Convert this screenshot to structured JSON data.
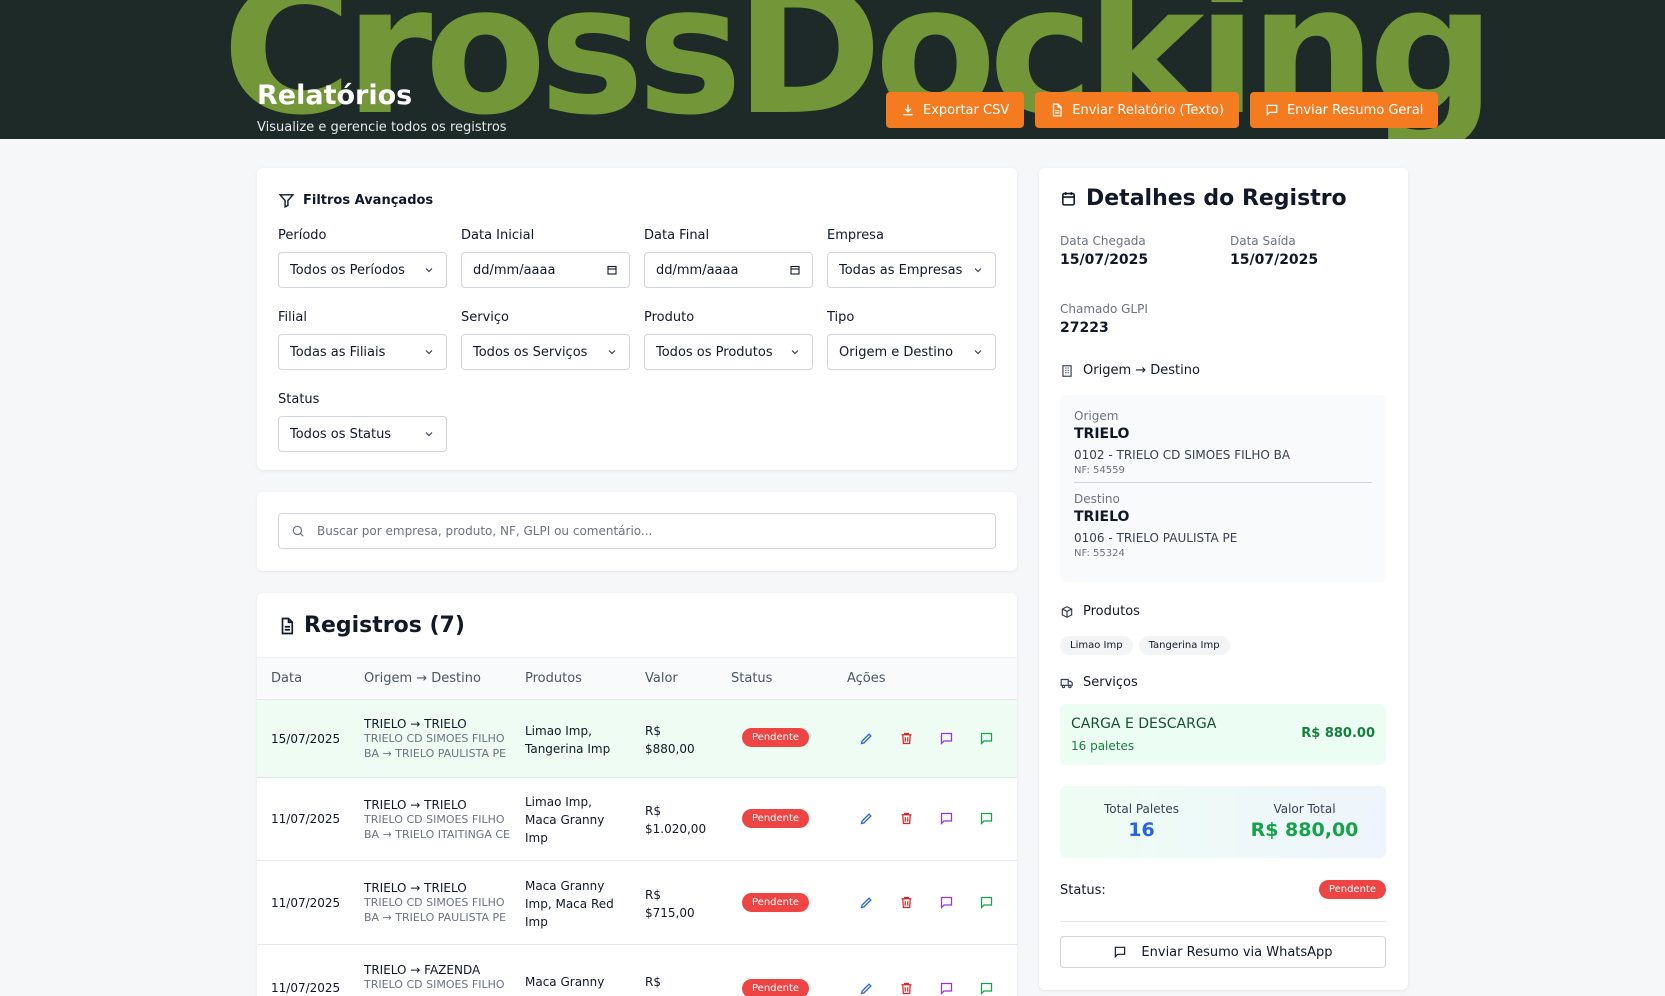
{
  "banner": {
    "background_word": "CrossDocking",
    "title": "Relatórios",
    "subtitle": "Visualize e gerencie todos os registros",
    "buttons": {
      "export_csv": "Exportar CSV",
      "send_report_text": "Enviar Relatório (Texto)",
      "send_summary": "Enviar Resumo Geral"
    },
    "accent_color": "#f47b20"
  },
  "filters": {
    "title": "Filtros Avançados",
    "fields": {
      "periodo": {
        "label": "Período",
        "value": "Todos os Períodos"
      },
      "data_inicial": {
        "label": "Data Inicial",
        "value": "dd/mm/aaaa"
      },
      "data_final": {
        "label": "Data Final",
        "value": "dd/mm/aaaa"
      },
      "empresa": {
        "label": "Empresa",
        "value": "Todas as Empresas"
      },
      "filial": {
        "label": "Filial",
        "value": "Todas as Filiais"
      },
      "servico": {
        "label": "Serviço",
        "value": "Todos os Serviços"
      },
      "produto": {
        "label": "Produto",
        "value": "Todos os Produtos"
      },
      "tipo": {
        "label": "Tipo",
        "value": "Origem e Destino"
      },
      "status": {
        "label": "Status",
        "value": "Todos os Status"
      }
    }
  },
  "search": {
    "placeholder": "Buscar por empresa, produto, NF, GLPI ou comentário..."
  },
  "records": {
    "title": "Registros (7)",
    "columns": {
      "data": "Data",
      "route": "Origem → Destino",
      "products": "Produtos",
      "value": "Valor",
      "status": "Status",
      "actions": "Ações"
    },
    "rows": [
      {
        "date": "15/07/2025",
        "route": "TRIELO → TRIELO",
        "route_detail_1": "TRIELO CD SIMOES FILHO",
        "route_detail_2": "BA → TRIELO PAULISTA PE",
        "products_1": "Limao Imp,",
        "products_2": "Tangerina Imp",
        "products_3": "",
        "value_1": "R$",
        "value_2": "$880,00",
        "status": "Pendente"
      },
      {
        "date": "11/07/2025",
        "route": "TRIELO → TRIELO",
        "route_detail_1": "TRIELO CD SIMOES FILHO",
        "route_detail_2": "BA → TRIELO ITAITINGA CE",
        "products_1": "Limao Imp,",
        "products_2": "Maca Granny",
        "products_3": "Imp",
        "value_1": "R$",
        "value_2": "$1.020,00",
        "status": "Pendente"
      },
      {
        "date": "11/07/2025",
        "route": "TRIELO → TRIELO",
        "route_detail_1": "TRIELO CD SIMOES FILHO",
        "route_detail_2": "BA → TRIELO PAULISTA PE",
        "products_1": "Maca Granny",
        "products_2": "Imp, Maca Red",
        "products_3": "Imp",
        "value_1": "R$",
        "value_2": "$715,00",
        "status": "Pendente"
      },
      {
        "date": "11/07/2025",
        "route": "TRIELO → FAZENDA",
        "route_detail_1": "TRIELO CD SIMOES FILHO",
        "route_detail_2": "",
        "products_1": "Maca Granny",
        "products_2": "",
        "products_3": "",
        "value_1": "R$",
        "value_2": "",
        "status": "Pendente"
      }
    ]
  },
  "details": {
    "title": "Detalhes do Registro",
    "arrival_label": "Data Chegada",
    "arrival": "15/07/2025",
    "departure_label": "Data Saída",
    "departure": "15/07/2025",
    "glpi_label": "Chamado GLPI",
    "glpi": "27223",
    "od_section": "Origem → Destino",
    "origin_label": "Origem",
    "origin_company": "TRIELO",
    "origin_branch": "0102 - TRIELO CD SIMOES FILHO BA",
    "origin_nf": "NF: 54559",
    "dest_label": "Destino",
    "dest_company": "TRIELO",
    "dest_branch": "0106 - TRIELO PAULISTA PE",
    "dest_nf": "NF: 55324",
    "products_section": "Produtos",
    "products": [
      "Limao Imp",
      "Tangerina Imp"
    ],
    "services_section": "Serviços",
    "service_name": "CARGA E DESCARGA",
    "service_qty": "16 paletes",
    "service_value": "R$ 880.00",
    "total_pallets_label": "Total Paletes",
    "total_pallets": "16",
    "total_value_label": "Valor Total",
    "total_value": "R$ 880,00",
    "status_label": "Status:",
    "status": "Pendente",
    "whatsapp_button": "Enviar Resumo via WhatsApp"
  }
}
